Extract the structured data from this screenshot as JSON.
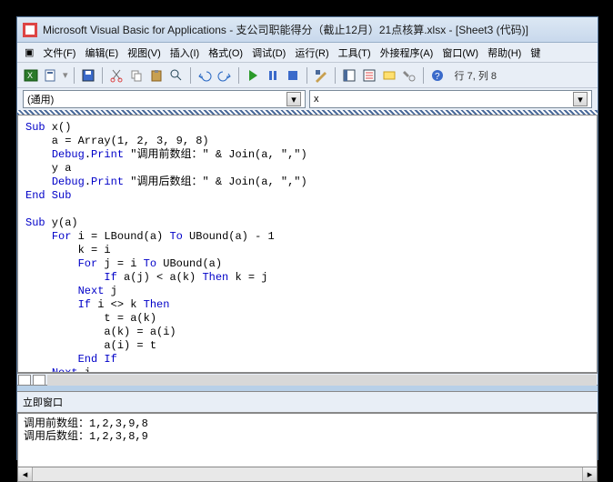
{
  "title": "Microsoft Visual Basic for Applications - 支公司职能得分（截止12月）21点核算.xlsx - [Sheet3 (代码)]",
  "menu": {
    "file": "文件(F)",
    "edit": "编辑(E)",
    "view": "视图(V)",
    "insert": "插入(I)",
    "format": "格式(O)",
    "debug": "调试(D)",
    "run": "运行(R)",
    "tools": "工具(T)",
    "addins": "外接程序(A)",
    "window": "窗口(W)",
    "help": "帮助(H)",
    "extra": "键"
  },
  "status": "行 7, 列 8",
  "selectors": {
    "left": "(通用)",
    "right": "x"
  },
  "code_html": "<span class='kw'>Sub</span> x()\n    a = Array(1, 2, 3, 9, 8)\n    <span class='fn'>Debug</span>.<span class='fn'>Print</span> \"调用前数组：\" & Join(a, \",\")\n    y a\n    <span class='fn'>Debug</span>.<span class='fn'>Print</span> \"调用后数组：\" & Join(a, \",\")\n<span class='kw'>End Sub</span>\n\n<span class='kw'>Sub</span> y(a)\n    <span class='kw'>For</span> i = LBound(a) <span class='kw'>To</span> UBound(a) - 1\n        k = i\n        <span class='kw'>For</span> j = i <span class='kw'>To</span> UBound(a)\n            <span class='kw'>If</span> a(j) < a(k) <span class='kw'>Then</span> k = j\n        <span class='kw'>Next</span> j\n        <span class='kw'>If</span> i <> k <span class='kw'>Then</span>\n            t = a(k)\n            a(k) = a(i)\n            a(i) = t\n        <span class='kw'>End If</span>\n    <span class='kw'>Next</span> i\n<span class='kw'>End Sub</span>",
  "immediate_label": "立即窗口",
  "immediate_text": "调用前数组：1,2,3,9,8\n调用后数组：1,2,3,8,9"
}
